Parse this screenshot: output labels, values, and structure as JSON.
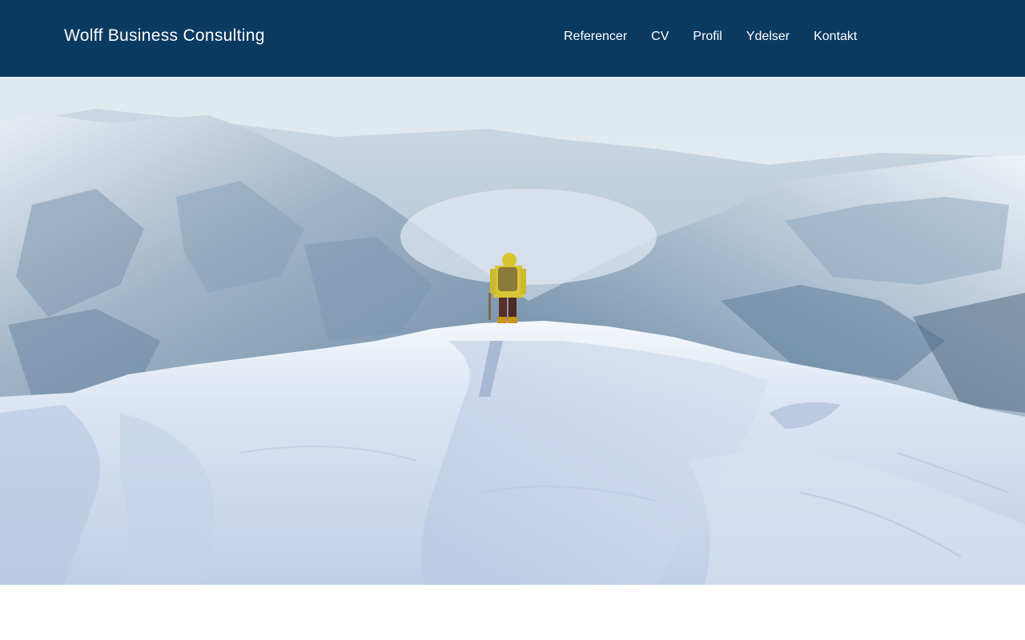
{
  "header": {
    "site_title": "Wolff Business Consulting",
    "nav": [
      {
        "label": "Referencer"
      },
      {
        "label": "CV"
      },
      {
        "label": "Profil"
      },
      {
        "label": "Ydelser"
      },
      {
        "label": "Kontakt"
      }
    ],
    "background_color": "#0b3a61"
  },
  "hero": {
    "image": "snowy-mountain-summit-hiker"
  }
}
